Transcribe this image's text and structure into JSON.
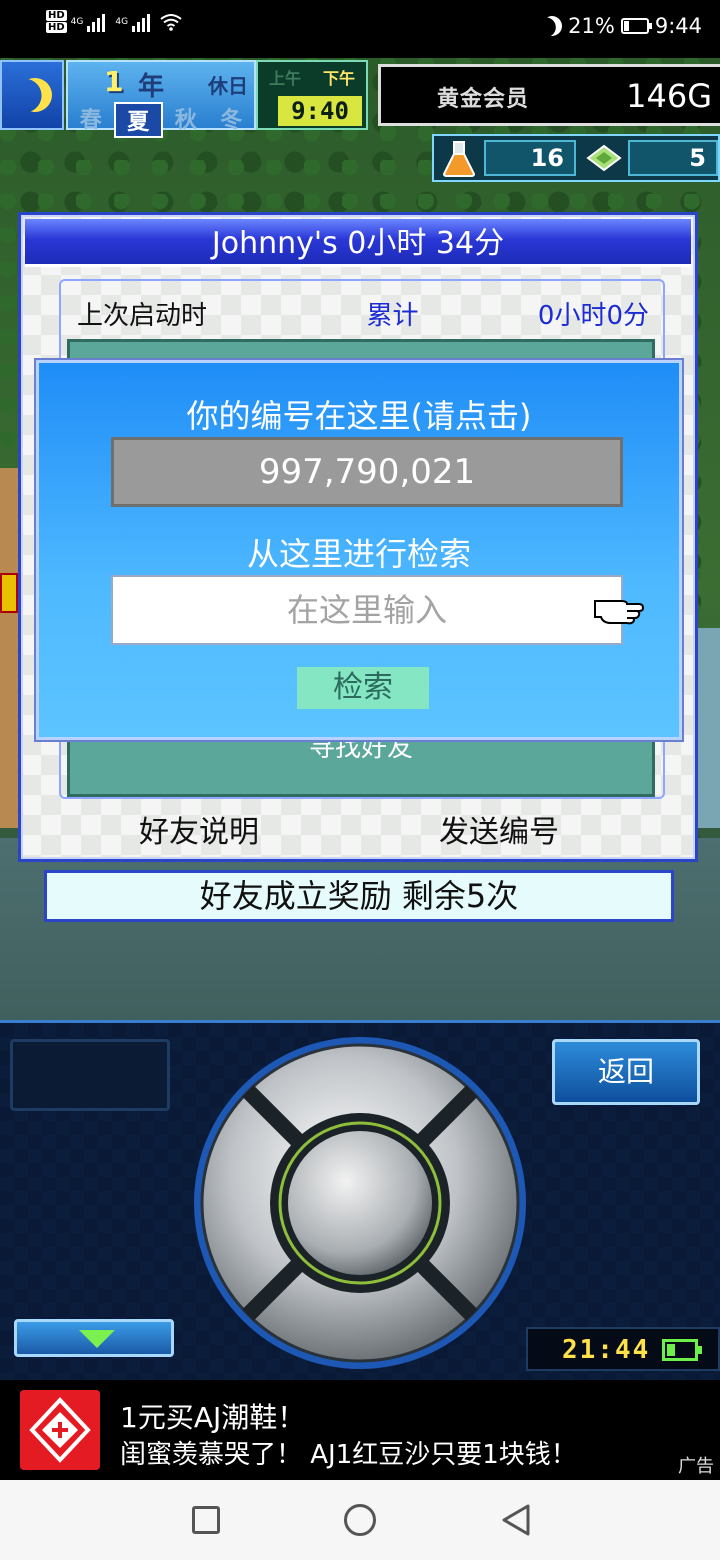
{
  "status_bar": {
    "network_badges": [
      "HD",
      "HD"
    ],
    "net_type_1": "4G",
    "net_type_2": "4G",
    "battery_percent": "21%",
    "time": "9:44",
    "icons": [
      "signal-icon",
      "wifi-icon",
      "moon-icon",
      "battery-icon"
    ]
  },
  "hud": {
    "year_number": "1",
    "year_char": "年",
    "day_type": "休日",
    "seasons": [
      "春",
      "夏",
      "秋",
      "冬"
    ],
    "current_season": "夏",
    "am_label": "上午",
    "pm_label": "下午",
    "current_period": "下午",
    "clock": "9:40",
    "rank": "黄金会员",
    "gold": "146G",
    "research_points": "16",
    "tickets": "5"
  },
  "friend_window": {
    "title": "Johnny's  0小时 34分",
    "last_launch_label": "上次启动时",
    "total_label": "累计",
    "total_value": "0小时0分",
    "hidden_button_text": "寻找好友",
    "friend_info_button": "好友说明",
    "send_id_button": "发送编号"
  },
  "reward_banner": "好友成立奖励  剩余5次",
  "id_dialog": {
    "title": "你的编号在这里(请点击)",
    "id_value": "997,790,021",
    "search_label": "从这里进行检索",
    "search_placeholder": "在这里输入",
    "search_button": "检索"
  },
  "controls": {
    "back_button": "返回",
    "game_time": "21:44"
  },
  "ad": {
    "title": "1元买AJ潮鞋！",
    "description": "闺蜜羡慕哭了！ AJ1红豆沙只要1块钱！",
    "ad_mark": "广告"
  },
  "colors": {
    "dialog_blue": "#1f8df7",
    "window_border": "#2b44c8",
    "teal_panel": "#5ba89a",
    "search_button": "#85e6c4"
  }
}
